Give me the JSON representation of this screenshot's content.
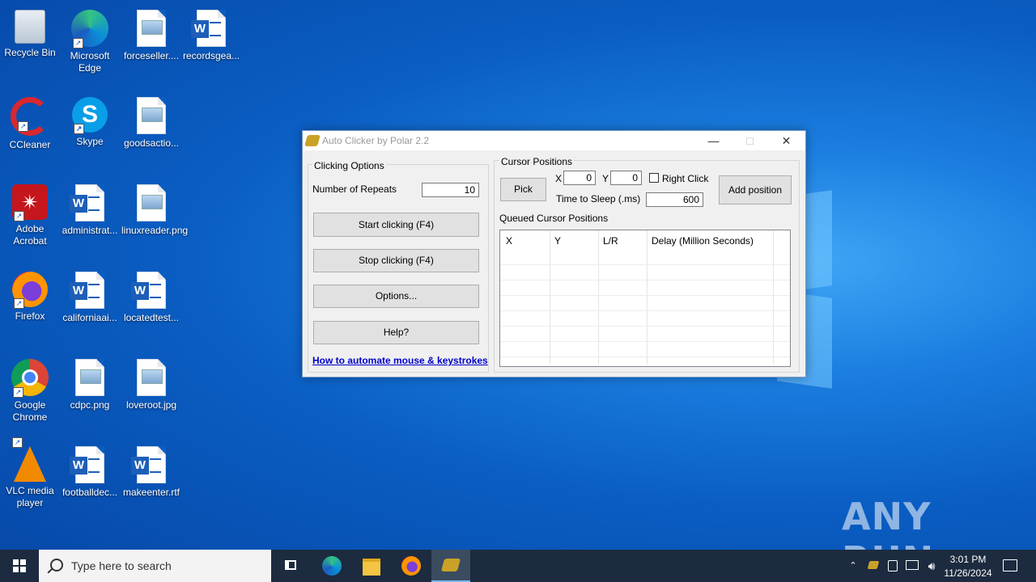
{
  "desktop": {
    "icons": [
      {
        "label": "Recycle Bin",
        "icon": "recycle-bin-icon"
      },
      {
        "label": "Microsoft Edge",
        "icon": "edge-icon"
      },
      {
        "label": "forceseller....",
        "icon": "image-file-icon"
      },
      {
        "label": "recordsgea...",
        "icon": "word-doc-icon"
      },
      {
        "label": "CCleaner",
        "icon": "ccleaner-icon"
      },
      {
        "label": "Skype",
        "icon": "skype-icon"
      },
      {
        "label": "goodsactio...",
        "icon": "image-file-icon"
      },
      {
        "label": "Adobe Acrobat",
        "icon": "acrobat-icon"
      },
      {
        "label": "administrat...",
        "icon": "word-doc-icon"
      },
      {
        "label": "linuxreader.png",
        "icon": "image-file-icon"
      },
      {
        "label": "Firefox",
        "icon": "firefox-icon"
      },
      {
        "label": "californiaai...",
        "icon": "word-doc-icon"
      },
      {
        "label": "locatedtest...",
        "icon": "word-doc-icon"
      },
      {
        "label": "Google Chrome",
        "icon": "chrome-icon"
      },
      {
        "label": "cdpc.png",
        "icon": "image-file-icon"
      },
      {
        "label": "loveroot.jpg",
        "icon": "image-file-icon"
      },
      {
        "label": "VLC media player",
        "icon": "vlc-icon"
      },
      {
        "label": "footballdec...",
        "icon": "word-doc-icon"
      },
      {
        "label": "makeenter.rtf",
        "icon": "word-doc-icon"
      }
    ]
  },
  "window": {
    "title": "Auto Clicker by Polar 2.2",
    "clicking_options": {
      "group_label": "Clicking Options",
      "repeats_label": "Number of Repeats",
      "repeats_value": "10",
      "start_button": "Start clicking (F4)",
      "stop_button": "Stop clicking (F4)",
      "options_button": "Options...",
      "help_button": "Help?",
      "link": "How to automate mouse & keystrokes"
    },
    "cursor_positions": {
      "group_label": "Cursor Positions",
      "pick_button": "Pick",
      "x_label": "X",
      "x_value": "0",
      "y_label": "Y",
      "y_value": "0",
      "right_click_label": "Right Click",
      "right_click_checked": false,
      "sleep_label": "Time to Sleep (.ms)",
      "sleep_value": "600",
      "add_button": "Add position",
      "queue_label": "Queued Cursor Positions",
      "columns": [
        "X",
        "Y",
        "L/R",
        "Delay (Million Seconds)"
      ]
    }
  },
  "taskbar": {
    "search_placeholder": "Type here to search",
    "time": "3:01 PM",
    "date": "11/26/2024"
  },
  "watermark": "ANY RUN"
}
